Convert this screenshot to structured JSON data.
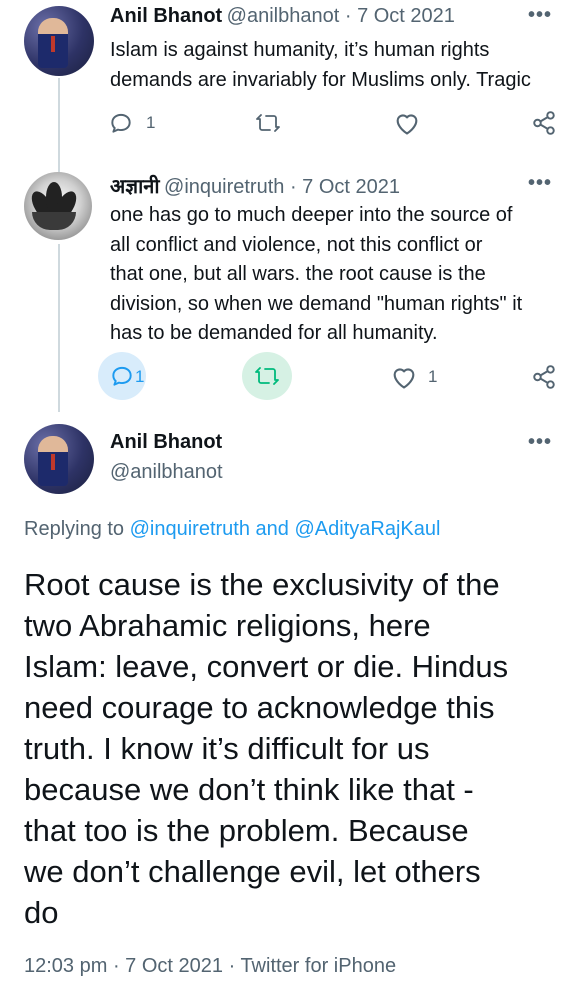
{
  "tweet1": {
    "name": "Anil Bhanot",
    "handle": "@anilbhanot",
    "sep": " · ",
    "date": "7 Oct 2021",
    "text_lines": [
      "Islam is against humanity, it’s human rights",
      "demands are invariably for Muslims only. Tragic"
    ],
    "reply_count": "1",
    "more_label": "•••"
  },
  "tweet2": {
    "name": "अज्ञानी",
    "handle": "@inquiretruth",
    "sep": " · ",
    "date": "7 Oct 2021",
    "text_lines": [
      "one has go to much deeper into the source of",
      "all conflict and violence, not this conflict or",
      "that one, but all wars. the root cause is the",
      "division, so when we demand \"human rights\" it",
      "has to be demanded for all humanity."
    ],
    "reply_count": "1",
    "like_count": "1",
    "more_label": "•••"
  },
  "main": {
    "name": "Anil Bhanot",
    "handle": "@anilbhanot",
    "replying_prefix": "Replying to ",
    "replying_user1": "@inquiretruth",
    "replying_and": " and ",
    "replying_user2": "@AdityaRajKaul",
    "text_lines": [
      "Root cause is the exclusivity of the",
      "two Abrahamic religions, here",
      "Islam: leave, convert or die. Hindus",
      "need courage to acknowledge this",
      "truth. I know it’s difficult for us",
      "because we don’t think like that -",
      "that too is the problem. Because",
      "we don’t challenge evil, let others",
      "do"
    ],
    "time": "12:03 pm",
    "sep": " · ",
    "date": "7 Oct 2021",
    "source": "Twitter for iPhone",
    "more_label": "•••"
  },
  "icons": {
    "reply": "reply-icon",
    "retweet": "retweet-icon",
    "like": "heart-icon",
    "share": "share-icon",
    "more": "more-icon"
  },
  "colors": {
    "text": "#0f1419",
    "muted": "#536471",
    "link": "#1d9bf0",
    "reply_active_bg": "#d8ecfb",
    "retweet_active_bg": "#d6f1e4",
    "retweet_active": "#00ba7c",
    "thread_line": "#cfd9de"
  }
}
